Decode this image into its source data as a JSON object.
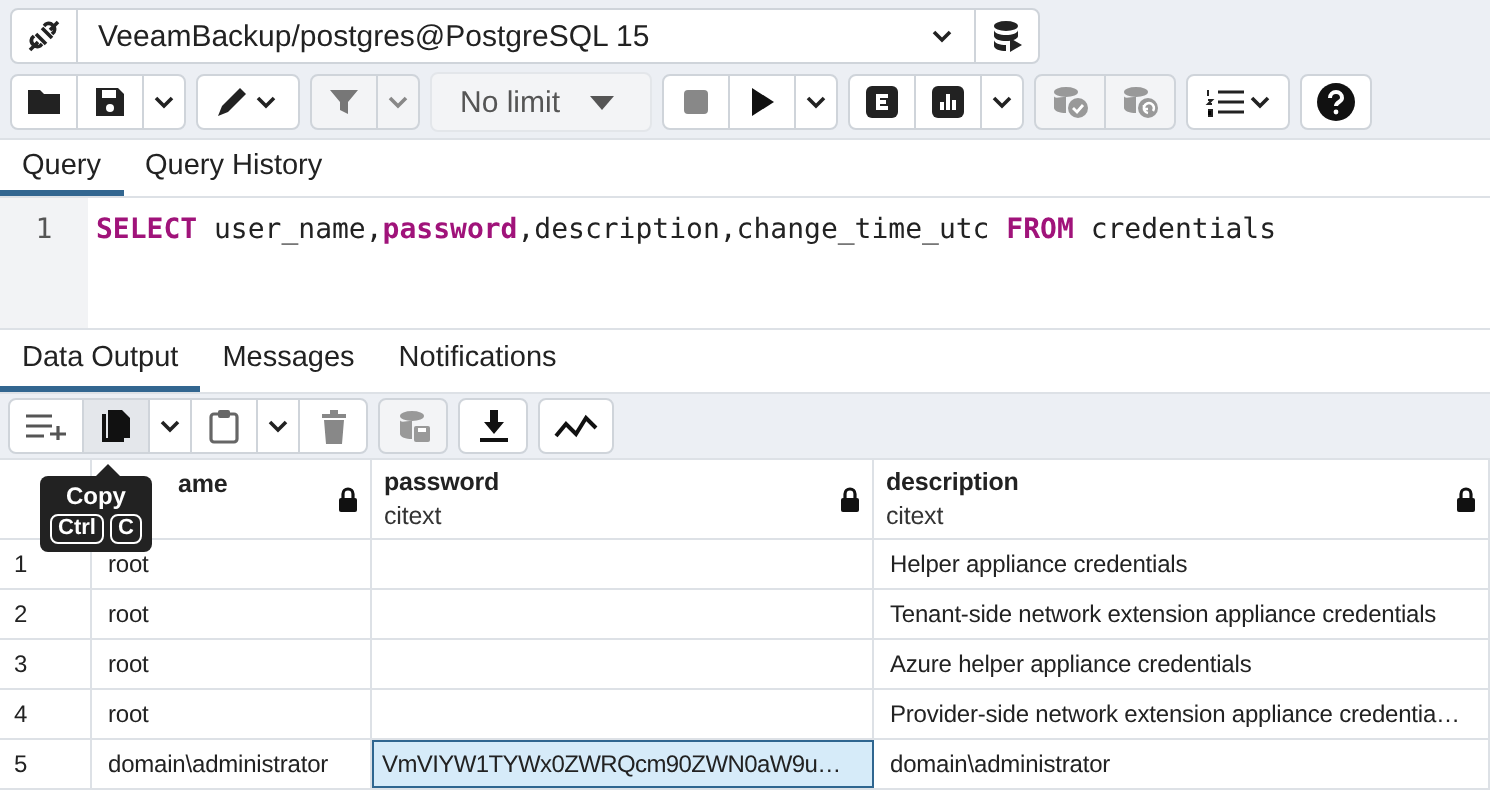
{
  "connection": {
    "value": "VeeamBackup/postgres@PostgreSQL 15"
  },
  "toolbar": {
    "limit": "No limit"
  },
  "editor_tabs": [
    {
      "label": "Query",
      "selected": true
    },
    {
      "label": "Query History",
      "selected": false
    }
  ],
  "editor": {
    "line_number": "1",
    "tokens": [
      {
        "text": "SELECT",
        "kind": "keyword"
      },
      {
        "text": " user_name,",
        "kind": "plain"
      },
      {
        "text": "password",
        "kind": "keyword"
      },
      {
        "text": ",description,change_time_utc ",
        "kind": "plain"
      },
      {
        "text": "FROM",
        "kind": "keyword"
      },
      {
        "text": " credentials",
        "kind": "plain"
      }
    ]
  },
  "output_tabs": [
    {
      "label": "Data Output",
      "selected": true
    },
    {
      "label": "Messages",
      "selected": false
    },
    {
      "label": "Notifications",
      "selected": false
    }
  ],
  "tooltip": {
    "title": "Copy",
    "keys": [
      "Ctrl",
      "C"
    ]
  },
  "table": {
    "columns": [
      {
        "name": "ame"
      },
      {
        "name": "password",
        "type": "citext"
      },
      {
        "name": "description",
        "type": "citext"
      }
    ],
    "rows": [
      {
        "number": "1",
        "cells": [
          {
            "text": "root",
            "selected": false
          },
          {
            "selected": false
          },
          {
            "text": "Helper appliance credentials",
            "selected": false
          }
        ]
      },
      {
        "number": "2",
        "cells": [
          {
            "text": "root",
            "selected": false
          },
          {
            "selected": false
          },
          {
            "text": "Tenant-side network extension appliance credentials",
            "selected": false
          }
        ]
      },
      {
        "number": "3",
        "cells": [
          {
            "text": "root",
            "selected": false
          },
          {
            "selected": false
          },
          {
            "text": "Azure helper appliance credentials",
            "selected": false
          }
        ]
      },
      {
        "number": "4",
        "cells": [
          {
            "text": "root",
            "selected": false
          },
          {
            "selected": false
          },
          {
            "text": "Provider-side network extension appliance credentia…",
            "selected": false
          }
        ]
      },
      {
        "number": "5",
        "cells": [
          {
            "text": "domain\\administrator",
            "selected": false
          },
          {
            "text": "VmVIYW1TYWx0ZWRQcm90ZWN0aW9u…",
            "selected": true
          },
          {
            "text": "domain\\administrator",
            "selected": false
          }
        ]
      }
    ]
  }
}
